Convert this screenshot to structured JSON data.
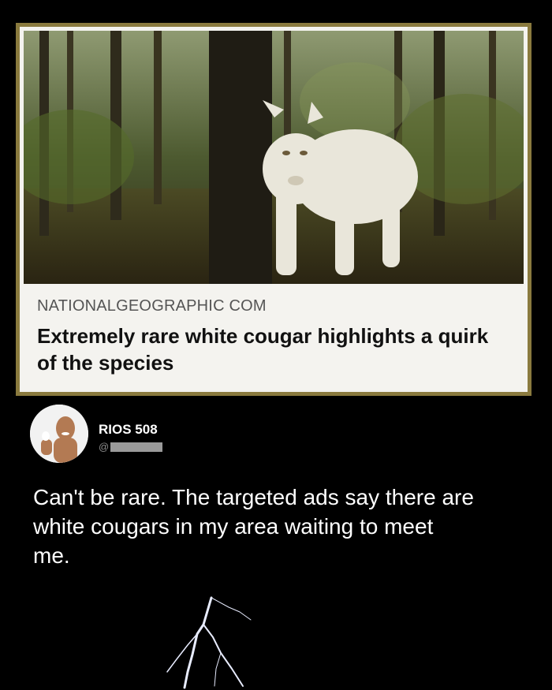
{
  "link_card": {
    "domain": "NATIONALGEOGRAPHIC COM",
    "title": "Extremely rare white cougar highlights a quirk of the species"
  },
  "post": {
    "author_name": "RIOS 508",
    "author_handle_prefix": "@",
    "text": "Can't be rare. The targeted ads say there are white cougars in my area waiting to meet me."
  },
  "colors": {
    "background": "#000000",
    "card_border": "#8a7a3e",
    "card_bg": "#f4f3ef",
    "lightning": "#e8ecff"
  },
  "icons": {
    "photo": "white-cougar-photo",
    "avatar": "user-avatar",
    "decoration": "lightning-bolt"
  }
}
